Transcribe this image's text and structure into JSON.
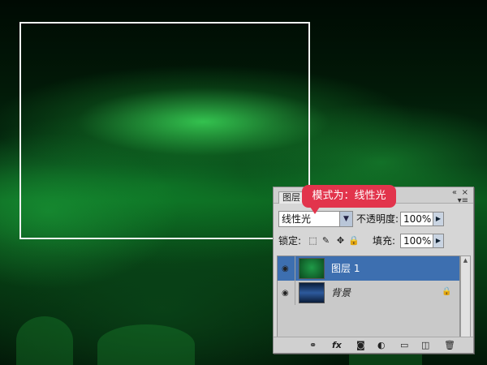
{
  "callout": {
    "text": "模式为：线性光"
  },
  "panel": {
    "tab_label": "图层",
    "close_glyph": "×",
    "collapse_glyph": "«",
    "menu_glyph": "▾≡",
    "blend_mode": "线性光",
    "opacity_label": "不透明度:",
    "opacity_value": "100%",
    "lock_label": "锁定:",
    "fill_label": "填充:",
    "fill_value": "100%",
    "layers": [
      {
        "name": "图层 1",
        "selected": true,
        "locked": false
      },
      {
        "name": "背景",
        "selected": false,
        "locked": true
      }
    ],
    "icons": [
      "link-icon",
      "fx-icon",
      "mask-icon",
      "adjustment-icon",
      "folder-icon",
      "new-layer-icon",
      "trash-icon"
    ],
    "fx_text": "fx"
  },
  "colors": {
    "selection_highlight": "#3d6fb0",
    "callout_bg": "#e2344c",
    "panel_bg": "#d6d6d6"
  }
}
